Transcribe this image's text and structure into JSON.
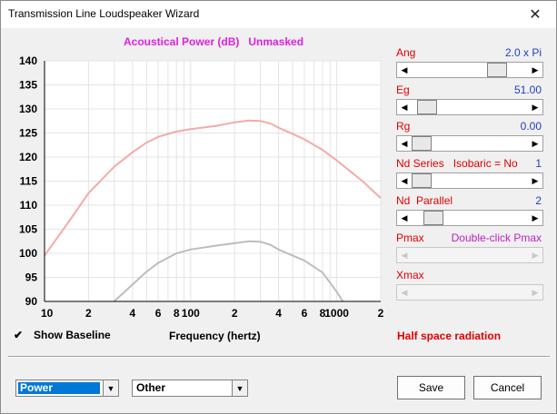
{
  "window": {
    "title": "Transmission Line Loudspeaker Wizard",
    "close_icon": "close-icon"
  },
  "chart_data": {
    "type": "line",
    "title": "Acoustical Power (dB)   Unmasked",
    "xlabel": "Frequency (hertz)",
    "ylabel": "",
    "x_scale": "log",
    "xlim": [
      10,
      2000
    ],
    "ylim": [
      90,
      140
    ],
    "yticks": [
      "140",
      "135",
      "130",
      "125",
      "120",
      "115",
      "110",
      "105",
      "100",
      "95",
      "90"
    ],
    "xticks": [
      {
        "value": 10,
        "label": "10"
      },
      {
        "value": 20,
        "label": "2"
      },
      {
        "value": 40,
        "label": "4"
      },
      {
        "value": 60,
        "label": "6"
      },
      {
        "value": 80,
        "label": "8"
      },
      {
        "value": 100,
        "label": "100"
      },
      {
        "value": 200,
        "label": "2"
      },
      {
        "value": 400,
        "label": "4"
      },
      {
        "value": 600,
        "label": "6"
      },
      {
        "value": 800,
        "label": "8"
      },
      {
        "value": 1000,
        "label": "1000"
      },
      {
        "value": 2000,
        "label": "2"
      }
    ],
    "grid": true,
    "series": [
      {
        "color": "#f4aaaa",
        "x": [
          10,
          15,
          20,
          30,
          40,
          50,
          60,
          80,
          100,
          150,
          200,
          250,
          300,
          350,
          400,
          500,
          600,
          800,
          1000,
          1500,
          2000
        ],
        "y": [
          99.5,
          107,
          112.5,
          118,
          121,
          123,
          124.2,
          125.3,
          125.8,
          126.5,
          127.2,
          127.6,
          127.5,
          127,
          126.1,
          124.8,
          123.7,
          121.5,
          119.3,
          115,
          111.5
        ]
      },
      {
        "color": "#bdbdbd",
        "x": [
          30,
          40,
          50,
          60,
          80,
          100,
          150,
          200,
          250,
          300,
          350,
          400,
          500,
          600,
          800,
          1000,
          1100
        ],
        "y": [
          90,
          93.5,
          96.2,
          98,
          100,
          100.8,
          101.6,
          102.1,
          102.5,
          102.4,
          101.8,
          100.8,
          99.5,
          98.5,
          96,
          92,
          90
        ]
      }
    ]
  },
  "controls": [
    {
      "label": "Ang",
      "value": "2.0 x Pi",
      "value_color": "blue",
      "thumb": 0.78,
      "enabled": true
    },
    {
      "label": "Eg",
      "value": "51.00",
      "value_color": "blue",
      "thumb": 0.06,
      "enabled": true
    },
    {
      "label": "Rg",
      "value": "0.00",
      "value_color": "blue",
      "thumb": 0.0,
      "enabled": true
    },
    {
      "label": "Nd Series   Isobaric = No",
      "value": "1",
      "value_color": "blue",
      "thumb": 0.0,
      "enabled": true
    },
    {
      "label": "Nd  Parallel",
      "value": "2",
      "value_color": "blue",
      "thumb": 0.12,
      "enabled": true
    },
    {
      "label": "Pmax",
      "value": "Double-click Pmax",
      "value_color": "magenta",
      "thumb": null,
      "enabled": false
    },
    {
      "label": "Xmax",
      "value": "",
      "value_color": "blue",
      "thumb": null,
      "enabled": false
    }
  ],
  "options": {
    "show_baseline_label": "Show Baseline",
    "show_baseline_checked": "✔",
    "half_space": "Half space radiation"
  },
  "footer": {
    "combo1": "Power",
    "combo2": "Other",
    "save": "Save",
    "cancel": "Cancel"
  }
}
